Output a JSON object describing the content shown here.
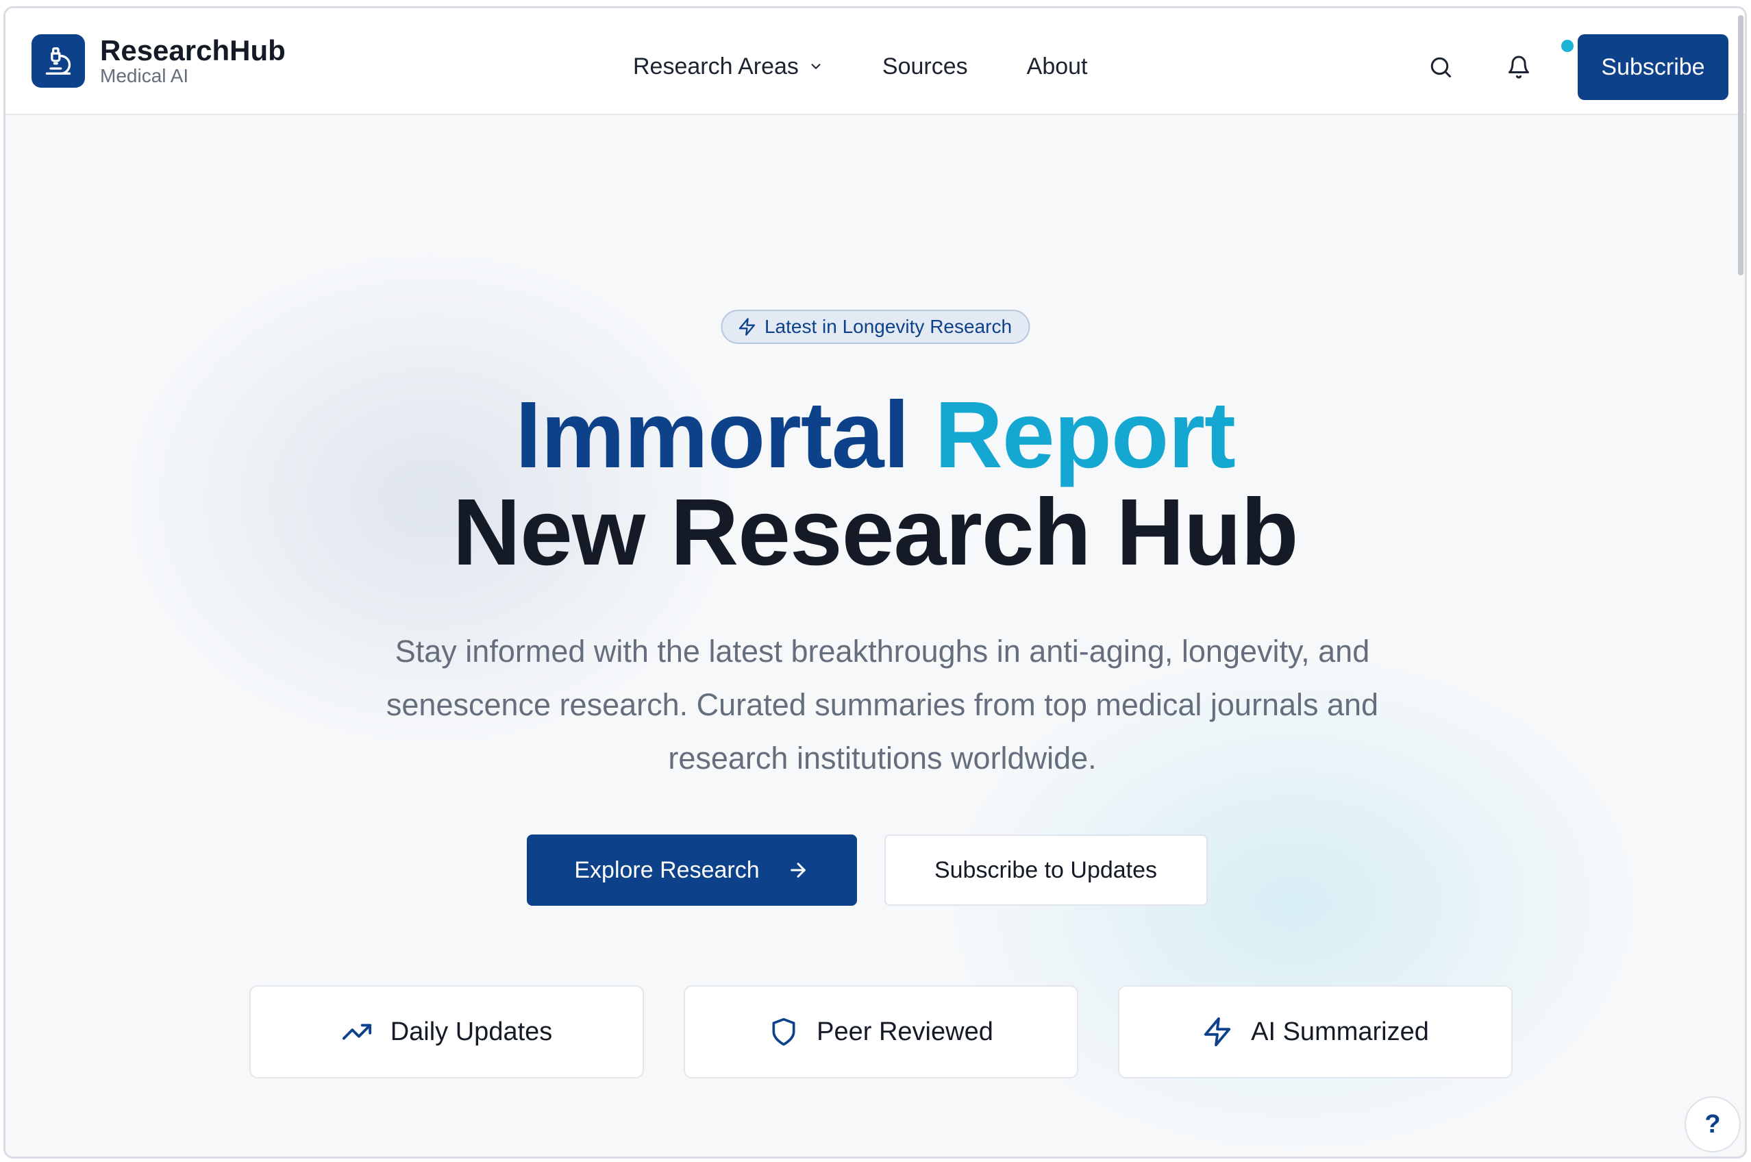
{
  "brand": {
    "name": "ResearchHub",
    "subtitle": "Medical AI",
    "logo_icon": "microscope-icon"
  },
  "nav": {
    "items": [
      {
        "label": "Research Areas",
        "has_dropdown": true
      },
      {
        "label": "Sources"
      },
      {
        "label": "About"
      }
    ],
    "search_icon": "search-icon",
    "notification_icon": "bell-icon",
    "subscribe_label": "Subscribe"
  },
  "hero": {
    "badge": "Latest in Longevity Research",
    "title_part1": "Immortal",
    "title_part2": "Report",
    "title_line2": "New Research Hub",
    "lead": "Stay informed with the latest breakthroughs in anti-aging, longevity, and senescence research. Curated summaries from top medical journals and research institutions worldwide.",
    "primary_cta": "Explore Research",
    "secondary_cta": "Subscribe to Updates"
  },
  "features": [
    {
      "label": "Daily Updates",
      "icon": "trending-up-icon"
    },
    {
      "label": "Peer Reviewed",
      "icon": "shield-icon"
    },
    {
      "label": "AI Summarized",
      "icon": "lightning-icon"
    }
  ],
  "help_label": "?",
  "colors": {
    "primary": "#0d428a",
    "accent": "#14a7d2",
    "text": "#141b26",
    "muted": "#646e7c",
    "notification_dot": "#1ab4d6"
  }
}
